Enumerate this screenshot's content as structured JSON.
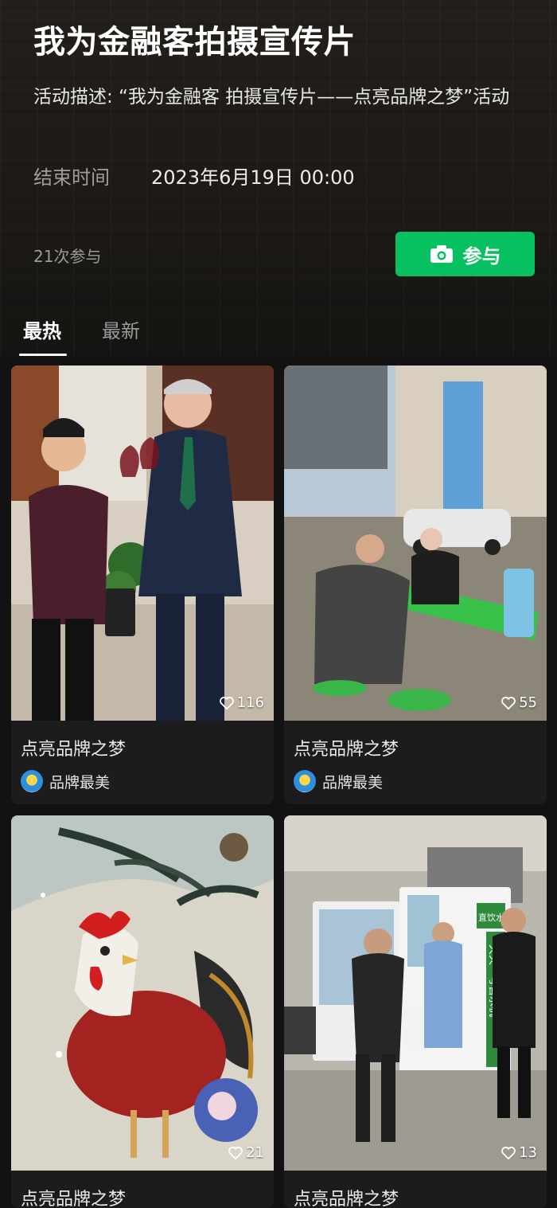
{
  "header": {
    "title": "我为金融客拍摄宣传片",
    "description": "活动描述: “我为金融客 拍摄宣传片——点亮品牌之梦”活动",
    "end_time_label": "结束时间",
    "end_time_value": "2023年6月19日 00:00",
    "participation_count": "21次参与",
    "join_button": {
      "label": "参与",
      "icon": "camera-icon",
      "color": "#07c160"
    }
  },
  "tabs": [
    {
      "label": "最热",
      "active": true
    },
    {
      "label": "最新",
      "active": false
    }
  ],
  "posts": [
    {
      "title": "点亮品牌之梦",
      "author": "品牌最美",
      "likes": "116",
      "image": "two men toasting with wine glasses"
    },
    {
      "title": "点亮品牌之梦",
      "author": "品牌最美",
      "likes": "55",
      "image": "people at a green table outdoors"
    },
    {
      "title": "点亮品牌之梦",
      "author": "",
      "likes": "21",
      "image": "painting of a rooster with pine branches"
    },
    {
      "title": "点亮品牌之梦",
      "author": "",
      "likes": "13",
      "image": "people at a water vending kiosk",
      "signs": [
        "直饮水",
        "天天一号售水机"
      ]
    }
  ],
  "colors": {
    "background": "#121212",
    "accent": "#07c160"
  }
}
